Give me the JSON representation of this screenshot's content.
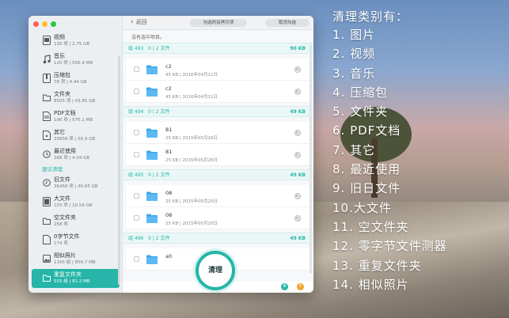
{
  "window": {
    "sidebar": {
      "items": [
        {
          "name": "视频",
          "meta": "130 项 | 2.75 GB",
          "icon": "video-icon"
        },
        {
          "name": "音乐",
          "meta": "120 项 | 556.9 MB",
          "icon": "music-icon"
        },
        {
          "name": "压缩包",
          "meta": "78 项 | 4.44 GB",
          "icon": "archive-icon"
        },
        {
          "name": "文件夹",
          "meta": "8505 项 | 43.85 GB",
          "icon": "folder-icon"
        },
        {
          "name": "PDF文档",
          "meta": "196 项 | 576.1 MB",
          "icon": "pdf-icon"
        },
        {
          "name": "其它",
          "meta": "30658 项 | 56.9 GB",
          "icon": "other-icon"
        },
        {
          "name": "最近使用",
          "meta": "288 项 | 4.04 GB",
          "icon": "clock-icon"
        }
      ],
      "section_header": "建议清理",
      "suggested": [
        {
          "name": "旧文件",
          "meta": "36458 项 | 46.65 GB",
          "icon": "old-file-icon"
        },
        {
          "name": "大文件",
          "meta": "103 项 | 10.59 GB",
          "icon": "large-file-icon"
        },
        {
          "name": "空文件夹",
          "meta": "258 项",
          "icon": "empty-folder-icon"
        },
        {
          "name": "0字节文件",
          "meta": "174 项",
          "icon": "zero-byte-icon"
        },
        {
          "name": "相似照片",
          "meta": "1165 组 | 856.7 MB",
          "icon": "photo-icon"
        },
        {
          "name": "重复文件夹",
          "meta": "503 组 | 81.2 MB",
          "icon": "duplicate-folder-icon",
          "selected": true
        }
      ]
    },
    "toolbar": {
      "back_label": "返回",
      "select_all_label": "勾选所有拷贝项",
      "deselect_label": "取消勾选"
    },
    "notice": "没有选中项目。",
    "groups": [
      {
        "label": "组 493",
        "count": "0 | 2 文件",
        "size": "90 KB",
        "files": [
          {
            "name": "c2",
            "meta": "45 KB | 2016年04月11日"
          },
          {
            "name": "c2",
            "meta": "45 KB | 2016年04月11日"
          }
        ]
      },
      {
        "label": "组 494",
        "count": "0 | 2 文件",
        "size": "49 KB",
        "files": [
          {
            "name": "81",
            "meta": "25 KB | 2015年05月26日"
          },
          {
            "name": "81",
            "meta": "25 KB | 2015年05月26日"
          }
        ]
      },
      {
        "label": "组 495",
        "count": "0 | 2 文件",
        "size": "49 KB",
        "files": [
          {
            "name": "08",
            "meta": "25 KB | 2015年05月20日"
          },
          {
            "name": "08",
            "meta": "25 KB | 2015年05月20日"
          }
        ]
      },
      {
        "label": "组 496",
        "count": "0 | 2 文件",
        "size": "49 KB",
        "files": [
          {
            "name": "a0",
            "meta": ""
          }
        ]
      }
    ],
    "clean_button": "清理"
  },
  "caption": {
    "title": "清理类别有：",
    "items": [
      "1. 图片",
      "2. 视频",
      "3. 音乐",
      "4. 压缩包",
      "5. 文件夹",
      "6. PDF文档",
      "7. 其它",
      "8. 最近使用",
      "9. 旧日文件",
      "10.大文件",
      "11. 空文件夹",
      "12. 零字节文件测器",
      "13. 重复文件夹",
      "14. 相似照片"
    ]
  },
  "colors": {
    "accent": "#26b5a8",
    "warning": "#f2a42a"
  }
}
